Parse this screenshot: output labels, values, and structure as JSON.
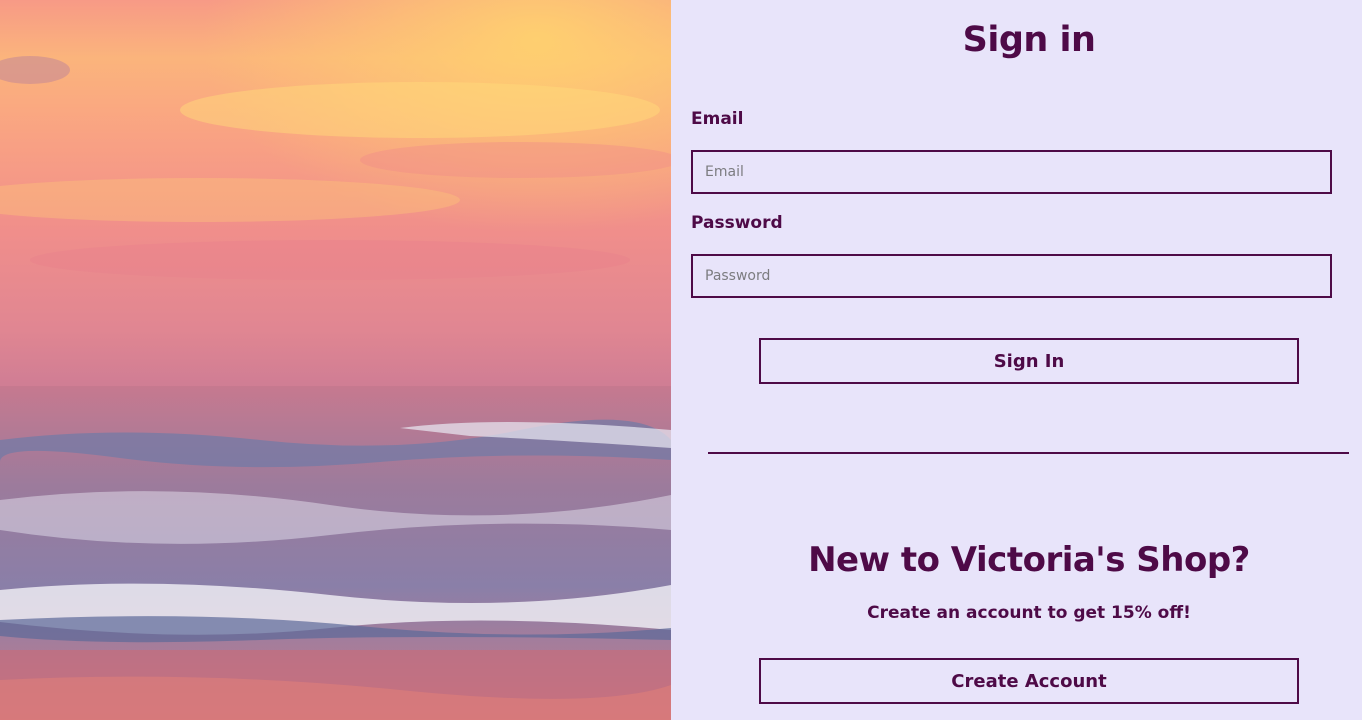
{
  "signin": {
    "title": "Sign in",
    "email_label": "Email",
    "email_placeholder": "Email",
    "password_label": "Password",
    "password_placeholder": "Password",
    "submit_label": "Sign In"
  },
  "register": {
    "heading": "New to Victoria's Shop?",
    "promo_text": "Create an account to get 15% off!",
    "create_label": "Create Account"
  },
  "colors": {
    "accent": "#4e0a47",
    "panel_background": "#e8e4fa"
  }
}
